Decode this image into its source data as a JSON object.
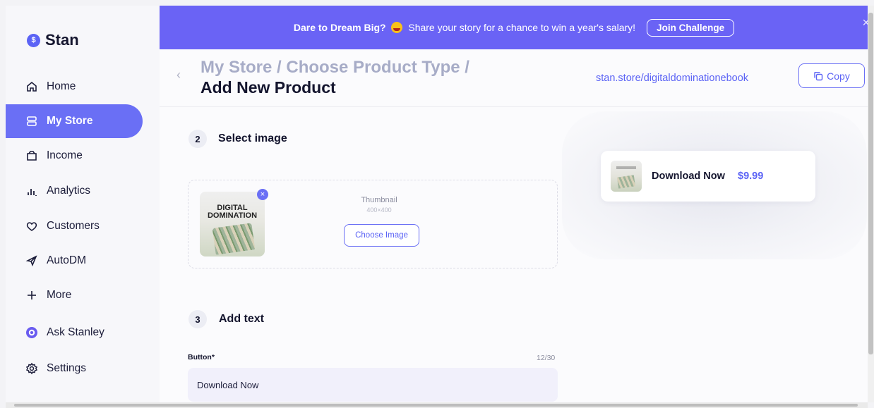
{
  "brand": {
    "name": "Stan",
    "logo_glyph": "$"
  },
  "sidebar": {
    "items": [
      {
        "label": "Home",
        "icon": "home-icon"
      },
      {
        "label": "My Store",
        "icon": "store-icon",
        "active": true
      },
      {
        "label": "Income",
        "icon": "wallet-icon"
      },
      {
        "label": "Analytics",
        "icon": "analytics-icon"
      },
      {
        "label": "Customers",
        "icon": "heart-icon"
      },
      {
        "label": "AutoDM",
        "icon": "send-icon"
      },
      {
        "label": "More",
        "icon": "plus-icon"
      },
      {
        "label": "Ask Stanley",
        "icon": "stanley-icon"
      },
      {
        "label": "Settings",
        "icon": "gear-icon"
      }
    ],
    "active_color": "#6a6ff5"
  },
  "banner": {
    "bold_text": "Dare to Dream Big?",
    "text": "Share your story for a chance to win a year's salary!",
    "button_label": "Join Challenge",
    "close_glyph": "×",
    "background": "#6a63f5"
  },
  "header": {
    "back_glyph": "‹",
    "breadcrumb": "My Store / Choose Product Type /",
    "current": "Add New Product",
    "store_url": "stan.store/digitaldominationebook",
    "copy_label": "Copy"
  },
  "steps": {
    "select_image": {
      "number": "2",
      "title": "Select image"
    },
    "add_text": {
      "number": "3",
      "title": "Add text"
    }
  },
  "image_upload": {
    "thumb_text": "DIGITAL DOMINATION",
    "remove_glyph": "×",
    "label": "Thumbnail",
    "size": "400×400",
    "button_label": "Choose Image"
  },
  "button_field": {
    "label": "Button*",
    "count": "12/30",
    "value": "Download Now"
  },
  "preview": {
    "title": "Download Now",
    "price": "$9.99",
    "accent": "#5b63f5"
  }
}
